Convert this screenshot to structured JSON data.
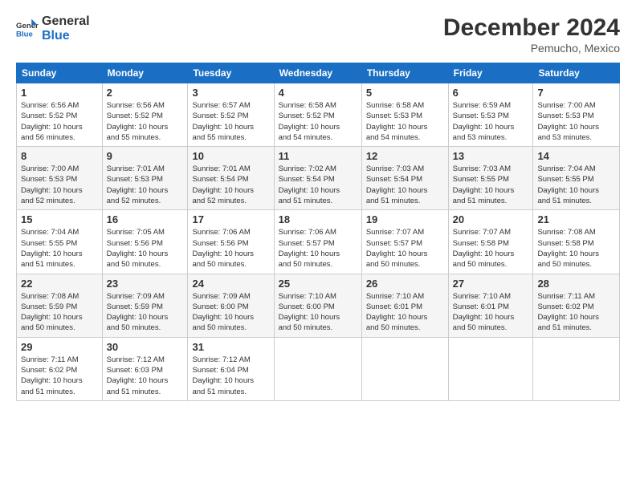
{
  "logo": {
    "line1": "General",
    "line2": "Blue"
  },
  "title": "December 2024",
  "subtitle": "Pemucho, Mexico",
  "weekdays": [
    "Sunday",
    "Monday",
    "Tuesday",
    "Wednesday",
    "Thursday",
    "Friday",
    "Saturday"
  ],
  "weeks": [
    [
      {
        "day": "1",
        "info": "Sunrise: 6:56 AM\nSunset: 5:52 PM\nDaylight: 10 hours\nand 56 minutes."
      },
      {
        "day": "2",
        "info": "Sunrise: 6:56 AM\nSunset: 5:52 PM\nDaylight: 10 hours\nand 55 minutes."
      },
      {
        "day": "3",
        "info": "Sunrise: 6:57 AM\nSunset: 5:52 PM\nDaylight: 10 hours\nand 55 minutes."
      },
      {
        "day": "4",
        "info": "Sunrise: 6:58 AM\nSunset: 5:52 PM\nDaylight: 10 hours\nand 54 minutes."
      },
      {
        "day": "5",
        "info": "Sunrise: 6:58 AM\nSunset: 5:53 PM\nDaylight: 10 hours\nand 54 minutes."
      },
      {
        "day": "6",
        "info": "Sunrise: 6:59 AM\nSunset: 5:53 PM\nDaylight: 10 hours\nand 53 minutes."
      },
      {
        "day": "7",
        "info": "Sunrise: 7:00 AM\nSunset: 5:53 PM\nDaylight: 10 hours\nand 53 minutes."
      }
    ],
    [
      {
        "day": "8",
        "info": "Sunrise: 7:00 AM\nSunset: 5:53 PM\nDaylight: 10 hours\nand 52 minutes."
      },
      {
        "day": "9",
        "info": "Sunrise: 7:01 AM\nSunset: 5:53 PM\nDaylight: 10 hours\nand 52 minutes."
      },
      {
        "day": "10",
        "info": "Sunrise: 7:01 AM\nSunset: 5:54 PM\nDaylight: 10 hours\nand 52 minutes."
      },
      {
        "day": "11",
        "info": "Sunrise: 7:02 AM\nSunset: 5:54 PM\nDaylight: 10 hours\nand 51 minutes."
      },
      {
        "day": "12",
        "info": "Sunrise: 7:03 AM\nSunset: 5:54 PM\nDaylight: 10 hours\nand 51 minutes."
      },
      {
        "day": "13",
        "info": "Sunrise: 7:03 AM\nSunset: 5:55 PM\nDaylight: 10 hours\nand 51 minutes."
      },
      {
        "day": "14",
        "info": "Sunrise: 7:04 AM\nSunset: 5:55 PM\nDaylight: 10 hours\nand 51 minutes."
      }
    ],
    [
      {
        "day": "15",
        "info": "Sunrise: 7:04 AM\nSunset: 5:55 PM\nDaylight: 10 hours\nand 51 minutes."
      },
      {
        "day": "16",
        "info": "Sunrise: 7:05 AM\nSunset: 5:56 PM\nDaylight: 10 hours\nand 50 minutes."
      },
      {
        "day": "17",
        "info": "Sunrise: 7:06 AM\nSunset: 5:56 PM\nDaylight: 10 hours\nand 50 minutes."
      },
      {
        "day": "18",
        "info": "Sunrise: 7:06 AM\nSunset: 5:57 PM\nDaylight: 10 hours\nand 50 minutes."
      },
      {
        "day": "19",
        "info": "Sunrise: 7:07 AM\nSunset: 5:57 PM\nDaylight: 10 hours\nand 50 minutes."
      },
      {
        "day": "20",
        "info": "Sunrise: 7:07 AM\nSunset: 5:58 PM\nDaylight: 10 hours\nand 50 minutes."
      },
      {
        "day": "21",
        "info": "Sunrise: 7:08 AM\nSunset: 5:58 PM\nDaylight: 10 hours\nand 50 minutes."
      }
    ],
    [
      {
        "day": "22",
        "info": "Sunrise: 7:08 AM\nSunset: 5:59 PM\nDaylight: 10 hours\nand 50 minutes."
      },
      {
        "day": "23",
        "info": "Sunrise: 7:09 AM\nSunset: 5:59 PM\nDaylight: 10 hours\nand 50 minutes."
      },
      {
        "day": "24",
        "info": "Sunrise: 7:09 AM\nSunset: 6:00 PM\nDaylight: 10 hours\nand 50 minutes."
      },
      {
        "day": "25",
        "info": "Sunrise: 7:10 AM\nSunset: 6:00 PM\nDaylight: 10 hours\nand 50 minutes."
      },
      {
        "day": "26",
        "info": "Sunrise: 7:10 AM\nSunset: 6:01 PM\nDaylight: 10 hours\nand 50 minutes."
      },
      {
        "day": "27",
        "info": "Sunrise: 7:10 AM\nSunset: 6:01 PM\nDaylight: 10 hours\nand 50 minutes."
      },
      {
        "day": "28",
        "info": "Sunrise: 7:11 AM\nSunset: 6:02 PM\nDaylight: 10 hours\nand 51 minutes."
      }
    ],
    [
      {
        "day": "29",
        "info": "Sunrise: 7:11 AM\nSunset: 6:02 PM\nDaylight: 10 hours\nand 51 minutes."
      },
      {
        "day": "30",
        "info": "Sunrise: 7:12 AM\nSunset: 6:03 PM\nDaylight: 10 hours\nand 51 minutes."
      },
      {
        "day": "31",
        "info": "Sunrise: 7:12 AM\nSunset: 6:04 PM\nDaylight: 10 hours\nand 51 minutes."
      },
      null,
      null,
      null,
      null
    ]
  ]
}
